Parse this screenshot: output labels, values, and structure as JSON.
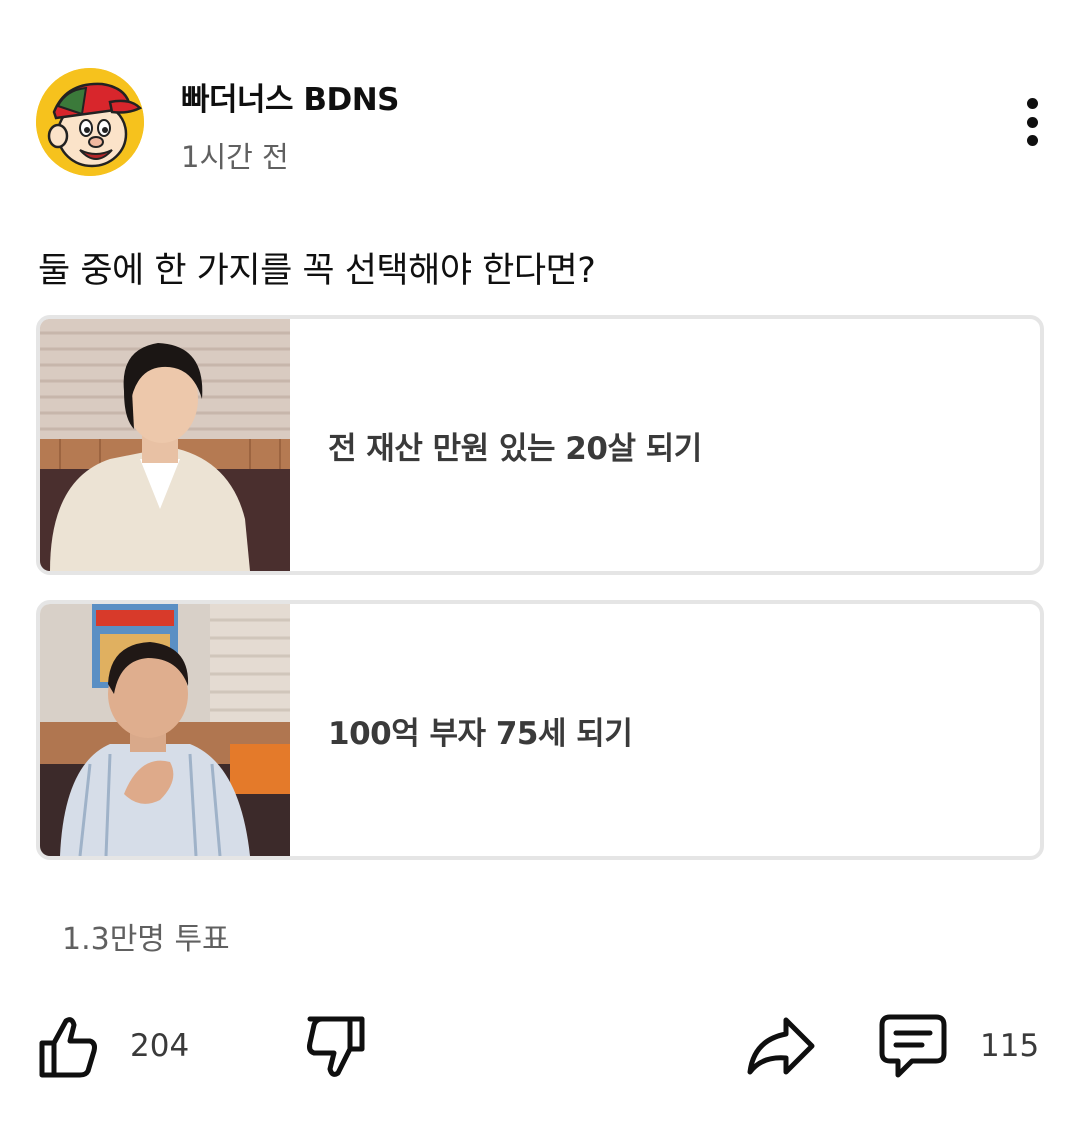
{
  "post": {
    "channel_name": "빠더너스 BDNS",
    "timestamp": "1시간 전",
    "question": "둘 중에 한 가지를 꼭 선택해야 한다면?",
    "options": [
      {
        "label": "전 재산 만원 있는 20살 되기"
      },
      {
        "label": "100억 부자 75세 되기"
      }
    ],
    "vote_count": "1.3만명 투표"
  },
  "actions": {
    "like_count": "204",
    "comment_count": "115"
  },
  "icons": {
    "menu": "more-vertical-icon",
    "like": "thumbs-up-icon",
    "dislike": "thumbs-down-icon",
    "share": "share-icon",
    "comment": "comment-icon"
  },
  "colors": {
    "avatar_bg": "#f6c21d",
    "text_primary": "#0f0f0f",
    "text_secondary": "#606060",
    "card_border": "#e5e5e5"
  }
}
